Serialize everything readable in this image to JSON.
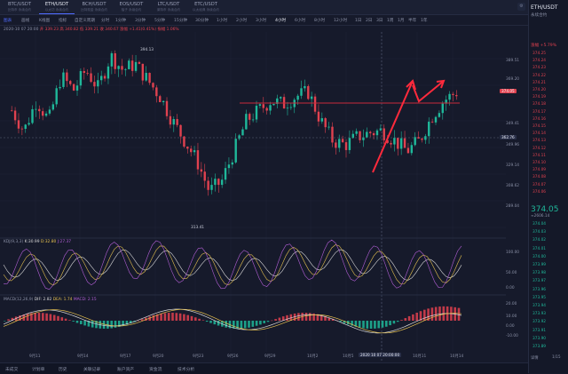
{
  "pairs": [
    {
      "name": "BTC/USDT",
      "sub": "比特币 永续合约"
    },
    {
      "name": "ETH/USDT",
      "sub": "以太坊 永续合约"
    },
    {
      "name": "BCH/USDT",
      "sub": "比特现金 永续合约"
    },
    {
      "name": "EOS/USDT",
      "sub": "柚子 永续合约"
    },
    {
      "name": "LTC/USDT",
      "sub": "莱特币 永续合约"
    },
    {
      "name": "ETC/USDT",
      "sub": "以太经典 永续合约"
    }
  ],
  "toolbar": {
    "chart_btn": "图表",
    "draw": "画线",
    "candle": "K线图",
    "indicator": "指标",
    "custom": "自定义周期",
    "intervals": [
      "分时",
      "1分钟",
      "3分钟",
      "5分钟",
      "15分钟",
      "30分钟",
      "1小时",
      "2小时",
      "3小时",
      "4小时",
      "6小时",
      "8小时",
      "12小时",
      "1日",
      "2日",
      "3日",
      "1周",
      "1月",
      "半年",
      "1年"
    ],
    "active_interval": "4小时"
  },
  "ohlc": {
    "time": "2020-10 07 20:00",
    "open": "开 339.23",
    "high": "高 340.82",
    "low": "低 339.21",
    "close": "收 340.67",
    "change": "涨幅 +1.41(0.41%)",
    "amp": "振幅 1.06%"
  },
  "price_labels": {
    "high": "394.13",
    "low": "313.41",
    "current": "374.05",
    "cross": "362.76",
    "upper_box": "349.96"
  },
  "right_axis": [
    "389.51",
    "369.20",
    "349.41",
    "329.14",
    "308.62",
    "289.04"
  ],
  "kdj": {
    "label": "KDJ(9,3,3)",
    "k": "K:30.99",
    "d": "D:32.80",
    "j": "J:27.37",
    "axis": [
      "100.00",
      "50.00",
      "0.00"
    ]
  },
  "macd": {
    "label": "MACD(12,26,9)",
    "dif": "DIF: 2.82",
    "dea": "DEA: 1.74",
    "macd": "MACD: 2.15",
    "axis": [
      "20.00",
      "10.00",
      "0.00",
      "-10.00"
    ]
  },
  "x_axis": [
    "9月11",
    "9月14",
    "9月17",
    "9月20",
    "9月23",
    "9月26",
    "9月29",
    "10月2",
    "10月5",
    "10月8",
    "10月11",
    "10月14"
  ],
  "x_cross": "2020 10 07 20:00:00",
  "right_panel": {
    "title": "ETH/USDT",
    "subtitle": "永续合约",
    "change": "涨幅 +5.79%",
    "ask_prices": [
      "374.25",
      "374.24",
      "374.23",
      "374.22",
      "374.21",
      "374.20",
      "374.19",
      "374.18",
      "374.17",
      "374.16",
      "374.15",
      "374.14",
      "374.13",
      "374.12",
      "374.11",
      "374.10",
      "374.09",
      "374.08",
      "374.07",
      "374.06"
    ],
    "last": "374.05",
    "last_sub": "≈2606.14",
    "bid_prices": [
      "374.04",
      "374.03",
      "374.02",
      "374.01",
      "374.00",
      "373.99",
      "373.98",
      "373.97",
      "373.96",
      "373.95",
      "373.94",
      "373.93",
      "373.92",
      "373.91",
      "373.90",
      "373.89"
    ],
    "tabs": [
      "详情",
      "1/15"
    ]
  },
  "bottom": [
    "未成交",
    "计划单",
    "历史",
    "关联记录",
    "账户资产",
    "资金流",
    "技术分析"
  ],
  "chart_data": {
    "type": "candlestick",
    "x": [
      "9月11",
      "9月14",
      "9月17",
      "9月20",
      "9月23",
      "9月26",
      "9月29",
      "10月2",
      "10月5",
      "10月8",
      "10月11",
      "10月14"
    ],
    "close_path": [
      365,
      355,
      370,
      360,
      382,
      375,
      385,
      376,
      392,
      385,
      388,
      380,
      372,
      360,
      350,
      340,
      325,
      330,
      345,
      360,
      365,
      370,
      368,
      372,
      374,
      360,
      350,
      348,
      352,
      354,
      355,
      350,
      345,
      350,
      362,
      370,
      374
    ],
    "high": 394.13,
    "low": 313.41,
    "ylim": [
      305,
      395
    ],
    "resistance": 372
  },
  "colors": {
    "up": "#1fb89a",
    "down": "#e0414f",
    "bg": "#161a2b",
    "accent": "#4f6bff"
  }
}
